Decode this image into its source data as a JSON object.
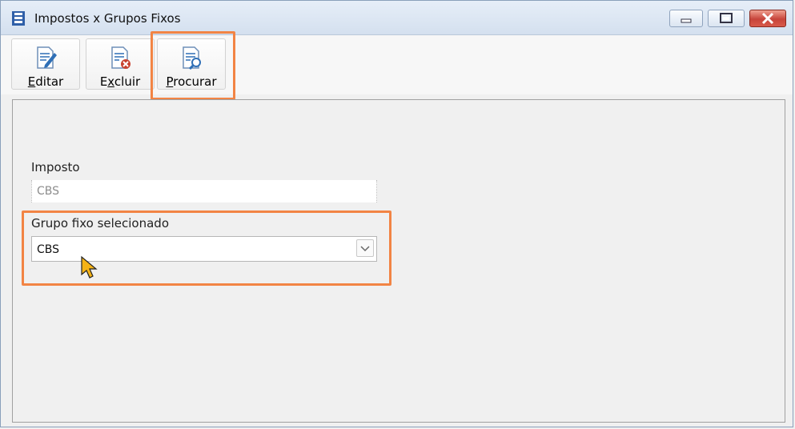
{
  "window": {
    "title": "Impostos x Grupos Fixos"
  },
  "toolbar": {
    "editar": {
      "label_hot": "E",
      "label_rest": "ditar"
    },
    "excluir": {
      "label_pre": "E",
      "label_hot": "x",
      "label_rest": "cluir"
    },
    "procurar": {
      "label_hot": "P",
      "label_rest": "rocurar"
    }
  },
  "form": {
    "imposto": {
      "label": "Imposto",
      "value": "CBS"
    },
    "grupo": {
      "label": "Grupo fixo selecionado",
      "value": "CBS"
    }
  },
  "colors": {
    "highlight": "#f28444",
    "accent": "#2f6fb6"
  }
}
